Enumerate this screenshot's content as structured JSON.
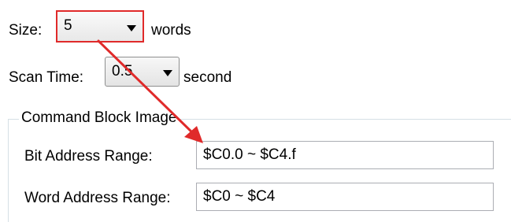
{
  "size": {
    "label": "Size:",
    "value": "5",
    "unit": "words"
  },
  "scan_time": {
    "label": "Scan Time:",
    "value": "0.5",
    "unit": "second"
  },
  "command_block": {
    "title": "Command Block Image",
    "bit_address": {
      "label": "Bit Address Range:",
      "value": "$C0.0 ~ $C4.f"
    },
    "word_address": {
      "label": "Word Address Range:",
      "value": "$C0 ~ $C4"
    }
  },
  "colors": {
    "highlight": "#e02a2a",
    "group_border": "#d5dfe5"
  }
}
